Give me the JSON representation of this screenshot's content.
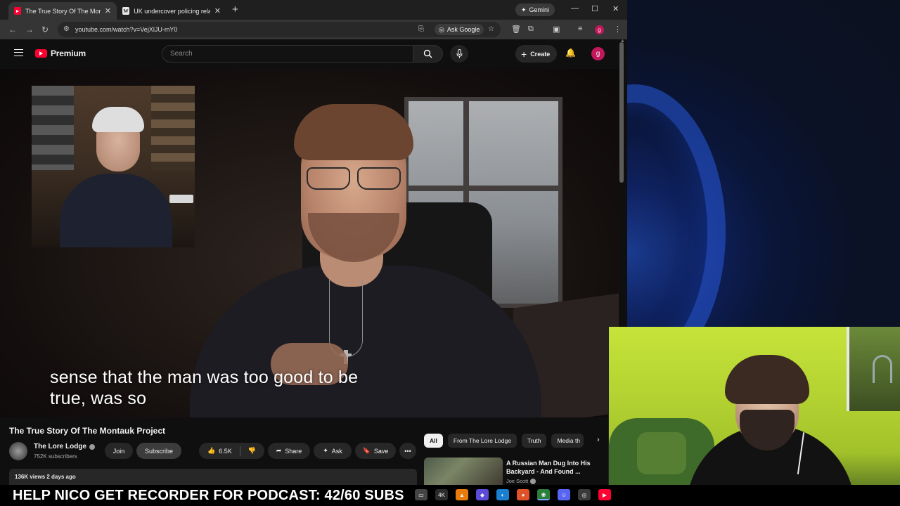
{
  "browser": {
    "tabs": [
      {
        "label": "The True Story Of The Montauk",
        "active": true,
        "favicon": "youtube-icon"
      },
      {
        "label": "UK undercover policing relation",
        "active": false,
        "favicon": "wikipedia-icon",
        "favicon_text": "W"
      }
    ],
    "gemini_label": "Gemini",
    "url": "youtube.com/watch?v=VejXlJU-mY0",
    "ask_google_label": "Ask Google",
    "profile_initial": "g"
  },
  "youtube": {
    "brand_label": "Premium",
    "search_placeholder": "Search",
    "create_label": "Create",
    "avatar_initial": "g",
    "captions": [
      "sense that the man was too good to be",
      "true, was so"
    ],
    "video_title": "The True Story Of The Montauk Project",
    "channel_name": "The Lore Lodge",
    "subscribers": "752K subscribers",
    "join_label": "Join",
    "subscribe_label": "Subscribe",
    "like_count": "6.5K",
    "share_label": "Share",
    "ask_label": "Ask",
    "save_label": "Save",
    "views_meta": "136K views  2 days ago",
    "chips": [
      "All",
      "From The Lore Lodge",
      "Truth",
      "Media th"
    ],
    "recommended": {
      "title": "A Russian Man Dug Into His Backyard - And Found ...",
      "channel": "Joe Scott"
    }
  },
  "banner": {
    "text": "HELP NICO GET RECORDER FOR PODCAST: 42/60 SUBS"
  },
  "taskbar": {
    "apps": [
      "tray-icon",
      "4K",
      "vlc-icon",
      "brave-icon",
      "edge-icon",
      "firefox-icon",
      "chrome-icon",
      "discord-icon",
      "obs-icon",
      "youtube-icon"
    ]
  },
  "colors": {
    "youtube_red": "#ff0033",
    "profile_pink": "#c2185b",
    "webcam_background": "#b6d432"
  }
}
